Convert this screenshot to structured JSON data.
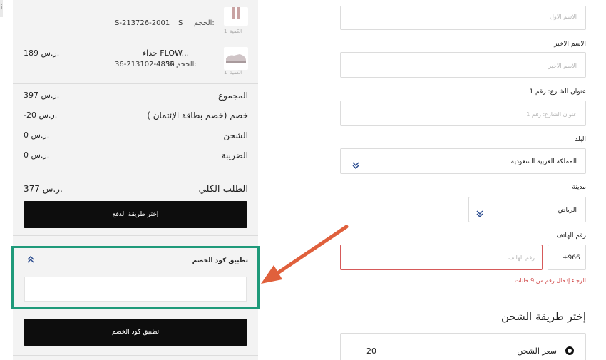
{
  "left_rail": {
    "mark": "i"
  },
  "items": [
    {
      "title": "",
      "size_label": "الحجم:",
      "size": "S",
      "sku": "S-213726-2001",
      "qty_label": "الكمية",
      "qty": "1",
      "price": ""
    },
    {
      "title": "حذاء FLOW...",
      "size_label": "الحجم:",
      "size": "36",
      "sku": "36-213102-4852",
      "qty_label": "الكمية",
      "qty": "1",
      "price": "189 ر.س."
    }
  ],
  "summary": {
    "subtotal_label": "المجموع",
    "subtotal": "397 ر.س.",
    "discount_label": "خصم (خصم بطاقة الإئتمان )",
    "discount": "-20 ر.س.",
    "shipping_label": "الشحن",
    "shipping": "0 ر.س.",
    "tax_label": "الضريبة",
    "tax": "0 ر.س.",
    "total_label": "الطلب الكلي",
    "total": "377 ر.س.",
    "choose_payment": "إختر طريقة الدفع"
  },
  "coupon": {
    "title": "تطبيق كود الخصم",
    "input_value": "",
    "apply_label": "تطبيق كود الخصم"
  },
  "form": {
    "first_name_placeholder": "الاسم الاول",
    "last_name_label": "الاسم الاخير",
    "last_name_placeholder": "الاسم الاخير",
    "street_label": "عنوان الشارع: رقم",
    "street_label_num": "1",
    "street_placeholder": "عنوان الشارع: رقم 1",
    "country_label": "البلد",
    "country_value": "المملكة العربية السعودية",
    "city_label": "مدينة",
    "city_value": "الرياض",
    "phone_label": "رقم الهاتف",
    "phone_code": "+966",
    "phone_placeholder": "رقم الهاتف",
    "phone_error": "الرجاء إدخال رقم من 9 خانات"
  },
  "shipping_method": {
    "title": "إختر طريقة الشحن",
    "option_label": "سعر الشحن",
    "option_value": "20"
  },
  "colors": {
    "highlight": "#1f9a7a",
    "arrow": "#e0603c",
    "error": "#d04848"
  }
}
